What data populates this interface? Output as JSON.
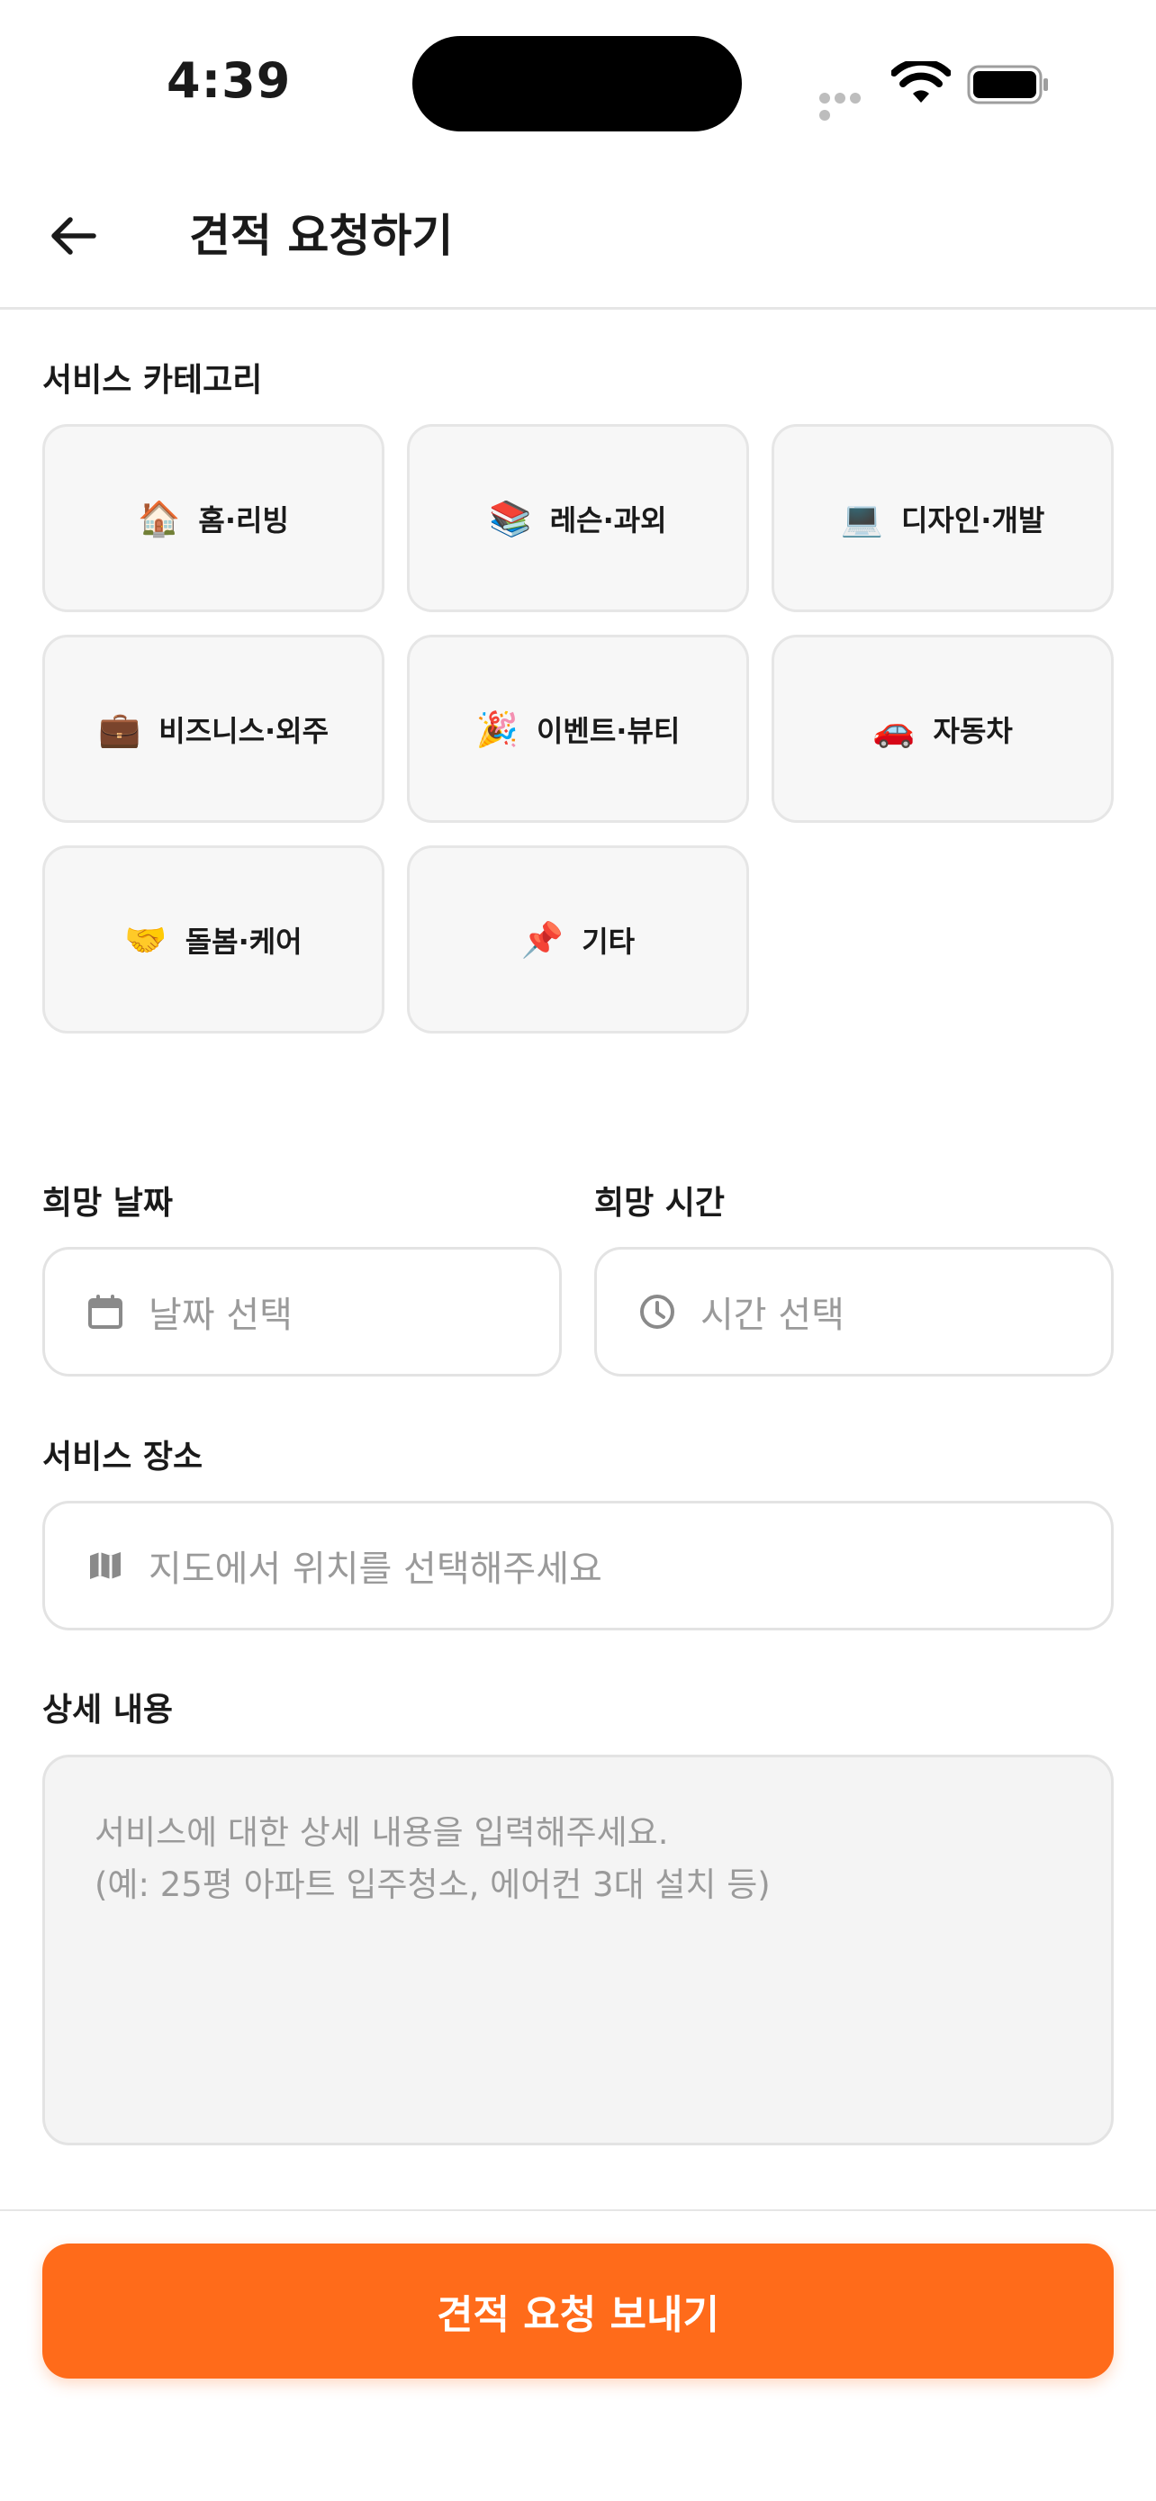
{
  "status_bar": {
    "time": "4:39"
  },
  "header": {
    "title": "견적 요청하기"
  },
  "category_section": {
    "label": "서비스 카테고리",
    "items": [
      {
        "icon": "🏠",
        "icon_name": "house-icon",
        "label": "홈·리빙"
      },
      {
        "icon": "📚",
        "icon_name": "books-icon",
        "label": "레슨·과외"
      },
      {
        "icon": "💻",
        "icon_name": "laptop-icon",
        "label": "디자인·개발"
      },
      {
        "icon": "💼",
        "icon_name": "briefcase-icon",
        "label": "비즈니스·외주"
      },
      {
        "icon": "🎉",
        "icon_name": "party-popper-icon",
        "label": "이벤트·뷰티"
      },
      {
        "icon": "🚗",
        "icon_name": "car-icon",
        "label": "자동차"
      },
      {
        "icon": "🤝",
        "icon_name": "handshake-icon",
        "label": "돌봄·케어"
      },
      {
        "icon": "📌",
        "icon_name": "pushpin-icon",
        "label": "기타"
      }
    ]
  },
  "date_field": {
    "label": "희망 날짜",
    "placeholder": "날짜 선택"
  },
  "time_field": {
    "label": "희망 시간",
    "placeholder": "시간 선택"
  },
  "location_field": {
    "label": "서비스 장소",
    "placeholder": "지도에서 위치를 선택해주세요"
  },
  "details_field": {
    "label": "상세 내용",
    "placeholder_line1": "서비스에 대한 상세 내용을 입력해주세요.",
    "placeholder_line2": "(예: 25평 아파트 입주청소, 에어컨 3대 설치 등)"
  },
  "submit": {
    "label": "견적 요청 보내기"
  },
  "colors": {
    "accent": "#ff6b1a",
    "card_bg": "#f7f7f7",
    "border": "#e3e3e3",
    "placeholder": "#9a9a9a"
  }
}
